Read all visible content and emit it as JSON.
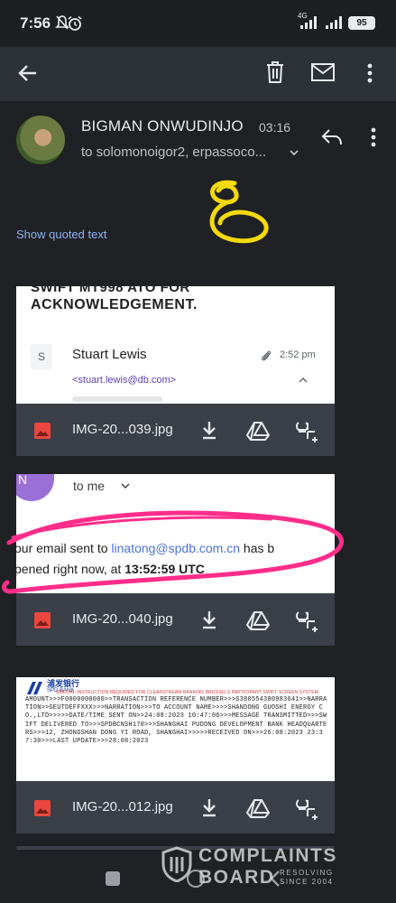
{
  "status_bar": {
    "time": "7:56",
    "network": "4G",
    "battery": "95"
  },
  "toolbar": {
    "back": "back-arrow",
    "delete": "trash",
    "mark_unread": "mail",
    "more": "more-vert"
  },
  "message": {
    "sender": "BIGMAN ONWUDINJO",
    "time": "03:16",
    "recipients": "to solomonoigor2, erpassoco..."
  },
  "show_quoted_text": "Show quoted text",
  "attachments": [
    {
      "preview": {
        "cut_heading": "SWIFT MT998 ATO FOR",
        "heading": "ACKNOWLEDGEMENT.",
        "avatar_letter": "S",
        "sender_name": "Stuart Lewis",
        "time": "2:52 pm",
        "email": "<stuart.lewis@db.com>"
      },
      "filename": "IMG-20...039.jpg"
    },
    {
      "preview": {
        "avatar_letter": "N",
        "to_me": "to me",
        "line1_pre": "our email sent to ",
        "line1_link": "linatong@spdb.com.cn",
        "line1_post": " has b",
        "line2_pre": "pened right now, at ",
        "line2_time": "13:52:59 UTC"
      },
      "filename": "IMG-20...040.jpg"
    },
    {
      "preview": {
        "bank_cn": "浦发银行",
        "bank_en": "SPD BANK",
        "red_title": "SPECIAL INSTRUCTION REQUIRED FOR CLEARSTREAM BANKING BRUSSELS PARTICIPANT SWIFT SCREEN SYSTEM",
        "swift_text": "AMOUNT>>>F0000000000>>TRANSACTION REFERENCE NUMBER>>>S3805543809836​41>>NARRATION>>GEUTDEFFXXX>>>NARRATION>>>TO ACCOUNT NAME>>>>SHANDONG GUOSHI ENERGY CO.,LTD>>>>>DATE/TIME SENT ON>>24:08:2023 10:47:06>>>MESSAGE TRANSMITTED>>>SWIFT DELIVERED TO>>>SPDBCNSH170>>>SHANGHAI PUDONG DEVELOPMENT BANK HEADQUARTERS>>>12, ZHONGSHAN DONG YI ROAD, SHANGHAI>>>>>RECEIVED ON>>>26:08:2023 23:37:30>>>LAST UPDATE>>>28:08:2023"
      },
      "filename": "IMG-20...012.jpg"
    }
  ],
  "watermark": {
    "line1": "COMPLAINTS",
    "line2": "BOARD",
    "tag1": "RESOLVING",
    "tag2": "SINCE 2004"
  },
  "colors": {
    "background": "#202124",
    "toolbar": "#2c3238",
    "link": "#8ab4f8",
    "highlight_pink": "#ff2d8a",
    "scribble_yellow": "#f5d90a"
  }
}
